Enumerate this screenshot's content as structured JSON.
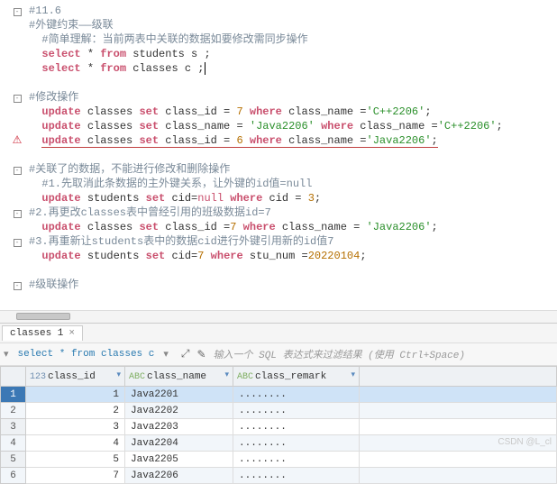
{
  "editor": {
    "lines": [
      {
        "g": "fold",
        "html": "<span class='comment'>#11.6</span>"
      },
      {
        "g": "",
        "html": "<span class='comment'>#外键约束——级联</span>"
      },
      {
        "g": "",
        "html": "  <span class='comment'>#简单理解：当前两表中关联的数据如要修改需同步操作</span>"
      },
      {
        "g": "",
        "html": "  <span class='kw'>select</span> * <span class='kw'>from</span> students s ;"
      },
      {
        "g": "",
        "html": "  <span class='kw'>select</span> * <span class='kw'>from</span> classes c ;<span class='caret'></span>"
      },
      {
        "g": "blank",
        "html": ""
      },
      {
        "g": "fold",
        "html": "<span class='comment'>#修改操作</span>"
      },
      {
        "g": "",
        "html": "  <span class='kw'>update</span> classes <span class='kw'>set</span> class_id = <span class='num'>7</span> <span class='kw'>where</span> class_name =<span class='str'>'C++2206'</span>;"
      },
      {
        "g": "",
        "html": "  <span class='kw'>update</span> classes <span class='kw'>set</span> class_name = <span class='str'>'Java2206'</span> <span class='kw'>where</span> class_name =<span class='str'>'C++2206'</span>;"
      },
      {
        "g": "err",
        "html": "  <span class='red-underline'><span class='kw'>update</span> classes <span class='kw'>set</span> class_id = <span class='num'>6</span> <span class='kw'>where</span> class_name =<span class='str'>'Java2206'</span>;</span>"
      },
      {
        "g": "blank",
        "html": ""
      },
      {
        "g": "fold",
        "html": "<span class='comment'>#关联了的数据，不能进行修改和删除操作</span>"
      },
      {
        "g": "",
        "html": "  <span class='comment'>#1.先取消此条数据的主外键关系，让外键的id值=null</span>"
      },
      {
        "g": "",
        "html": "  <span class='kw'>update</span> students <span class='kw'>set</span> cid=<span class='kw2'>null</span> <span class='kw'>where</span> cid = <span class='num'>3</span>;"
      },
      {
        "g": "fold",
        "html": "<span class='comment'>#2.再更改classes表中曾经引用的班级数据id=7</span>"
      },
      {
        "g": "",
        "html": "  <span class='kw'>update</span> classes <span class='kw'>set</span> class_id =<span class='num'>7</span> <span class='kw'>where</span> class_name = <span class='str'>'Java2206'</span>;"
      },
      {
        "g": "fold",
        "html": "<span class='comment'>#3.再重新让students表中的数据cid进行外键引用新的id值7</span>"
      },
      {
        "g": "",
        "html": "  <span class='kw'>update</span> students <span class='kw'>set</span> cid=<span class='num'>7</span> <span class='kw'>where</span> stu_num =<span class='num'>20220104</span>;"
      },
      {
        "g": "blank",
        "html": ""
      },
      {
        "g": "fold",
        "html": "<span class='comment'>#级联操作</span>"
      },
      {
        "g": "blank",
        "html": ""
      }
    ]
  },
  "tab": {
    "label": "classes 1",
    "close": "×"
  },
  "filter": {
    "query": "select * from classes c",
    "dd_glyph": "▾",
    "expand_glyph": "⤢",
    "pencil": "✎",
    "hint": "输入一个 SQL 表达式来过滤结果 (使用 Ctrl+Space)"
  },
  "table": {
    "headers": {
      "rownum": "",
      "id": "class_id",
      "name": "class_name",
      "remark": "class_remark",
      "id_prefix": "123",
      "txt_prefix": "ABC",
      "dd_glyph": "▾"
    },
    "rows": [
      {
        "n": "1",
        "id": "1",
        "name": "Java2201",
        "remark": "........",
        "sel": true
      },
      {
        "n": "2",
        "id": "2",
        "name": "Java2202",
        "remark": "........"
      },
      {
        "n": "3",
        "id": "3",
        "name": "Java2203",
        "remark": "........"
      },
      {
        "n": "4",
        "id": "4",
        "name": "Java2204",
        "remark": "........"
      },
      {
        "n": "5",
        "id": "5",
        "name": "Java2205",
        "remark": "........"
      },
      {
        "n": "6",
        "id": "7",
        "name": "Java2206",
        "remark": "........"
      }
    ]
  },
  "watermark": "CSDN @L_cl"
}
